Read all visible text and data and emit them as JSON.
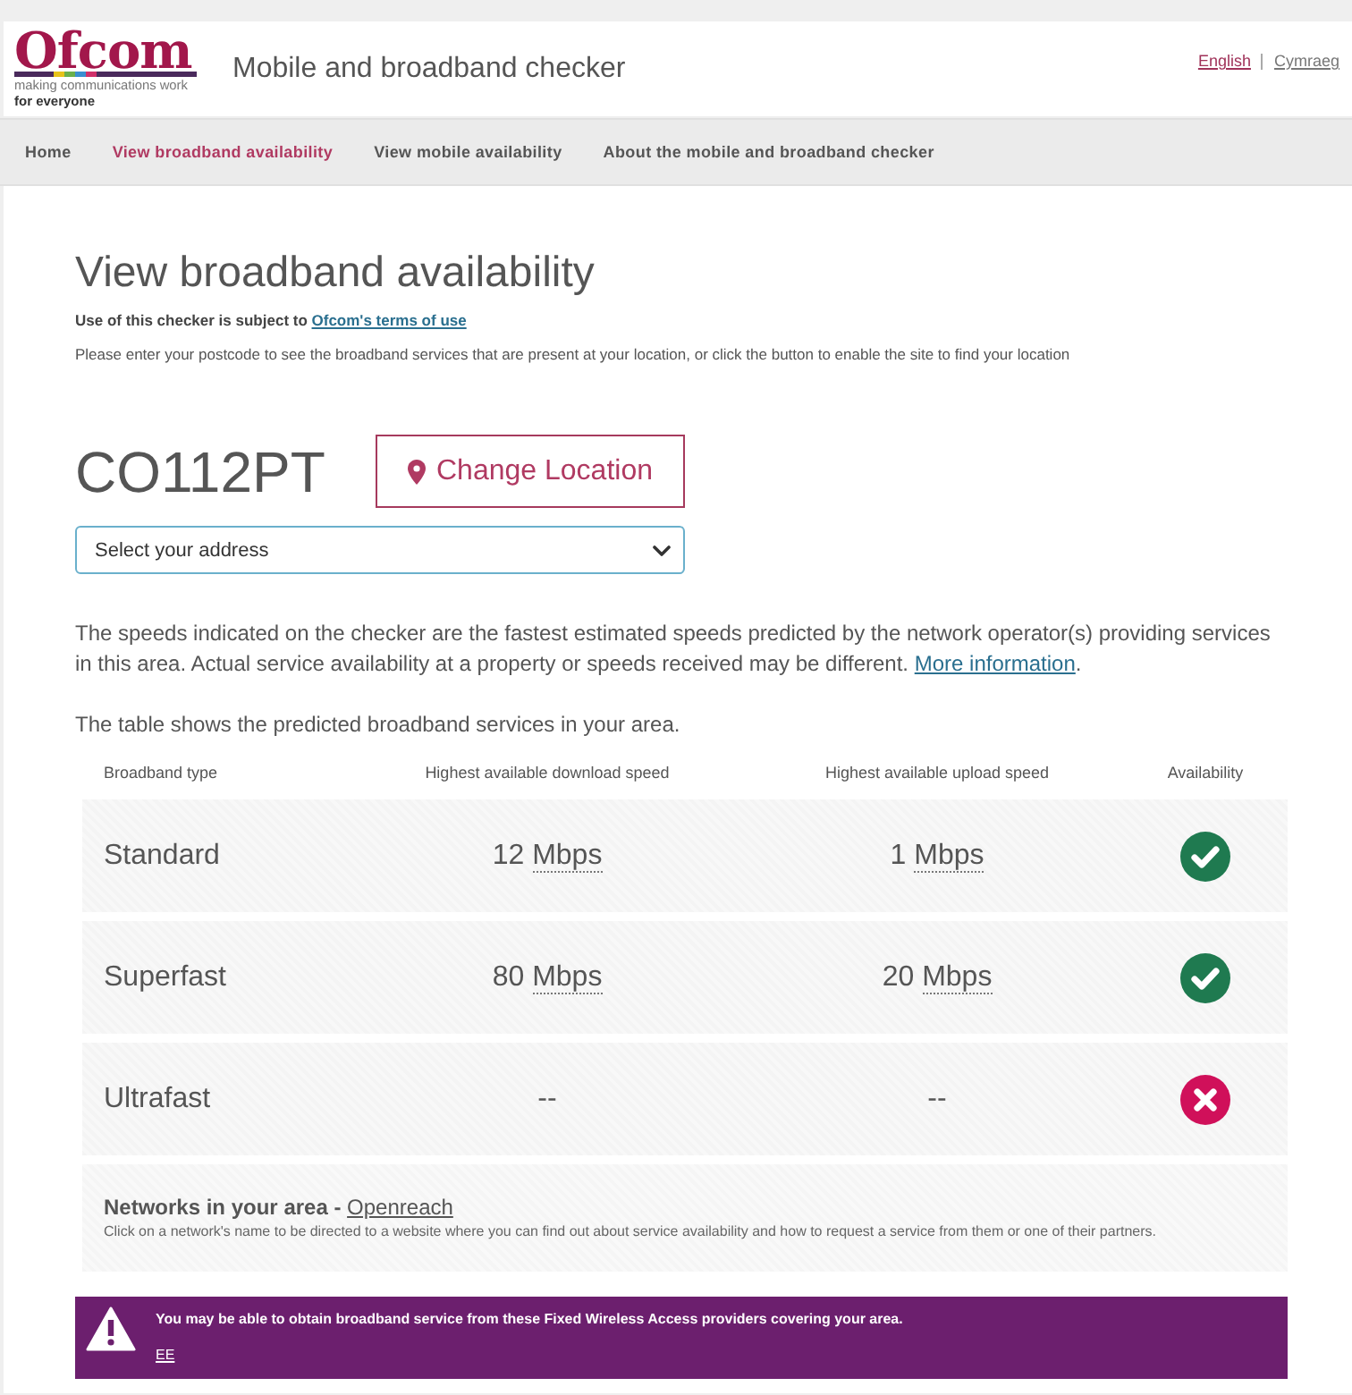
{
  "header": {
    "logo": {
      "wordmark": "Ofcom",
      "tagline": "making communications work",
      "tagline_emphasis": "for everyone"
    },
    "title": "Mobile and broadband checker",
    "languages": [
      {
        "label": "English",
        "selected": true
      },
      {
        "label": "Cymraeg",
        "selected": false
      }
    ]
  },
  "nav": {
    "items": [
      {
        "label": "Home",
        "selected": false
      },
      {
        "label": "View broadband availability",
        "selected": true
      },
      {
        "label": "View mobile availability",
        "selected": false
      },
      {
        "label": "About the mobile and broadband checker",
        "selected": false
      }
    ]
  },
  "page": {
    "heading": "View broadband availability",
    "terms": {
      "text": "Use of this checker is subject to",
      "link": "Ofcom's terms of use"
    },
    "instructions": "Please enter your postcode to see the broadband services that are present at your location, or click the button to enable the site to find your location",
    "postcode": "CO112PT",
    "change_location_button": "Change Location",
    "address_select": {
      "value": "Select your address"
    },
    "disclaimer": {
      "text": "The speeds indicated on the checker are the fastest estimated speeds predicted by the network operator(s) providing services in this area. Actual service availability at a property or speeds received may be different.",
      "link": "More information",
      "end": "."
    },
    "table_intro": "The table shows the predicted broadband services in your area."
  },
  "table": {
    "columns": [
      "Broadband type",
      "Highest available download speed",
      "Highest available upload speed",
      "Availability"
    ],
    "rows": [
      {
        "type": "Standard",
        "download": {
          "value": "12",
          "unit": "Mbps"
        },
        "upload": {
          "value": "1",
          "unit": "Mbps"
        },
        "available": true
      },
      {
        "type": "Superfast",
        "download": {
          "value": "80",
          "unit": "Mbps"
        },
        "upload": {
          "value": "20",
          "unit": "Mbps"
        },
        "available": true
      },
      {
        "type": "Ultrafast",
        "download": {
          "value": "--"
        },
        "upload": {
          "value": "--"
        },
        "available": false
      }
    ]
  },
  "networks": {
    "label": "Networks in your area -",
    "link": "Openreach",
    "note": "Click on a network's name to be directed to a website where you can find out about service availability and how to request a service from them or one of their partners."
  },
  "fwa_banner": {
    "message": "You may be able to obtain broadband service from these Fixed Wireless Access providers covering your area.",
    "providers": [
      "EE"
    ]
  }
}
